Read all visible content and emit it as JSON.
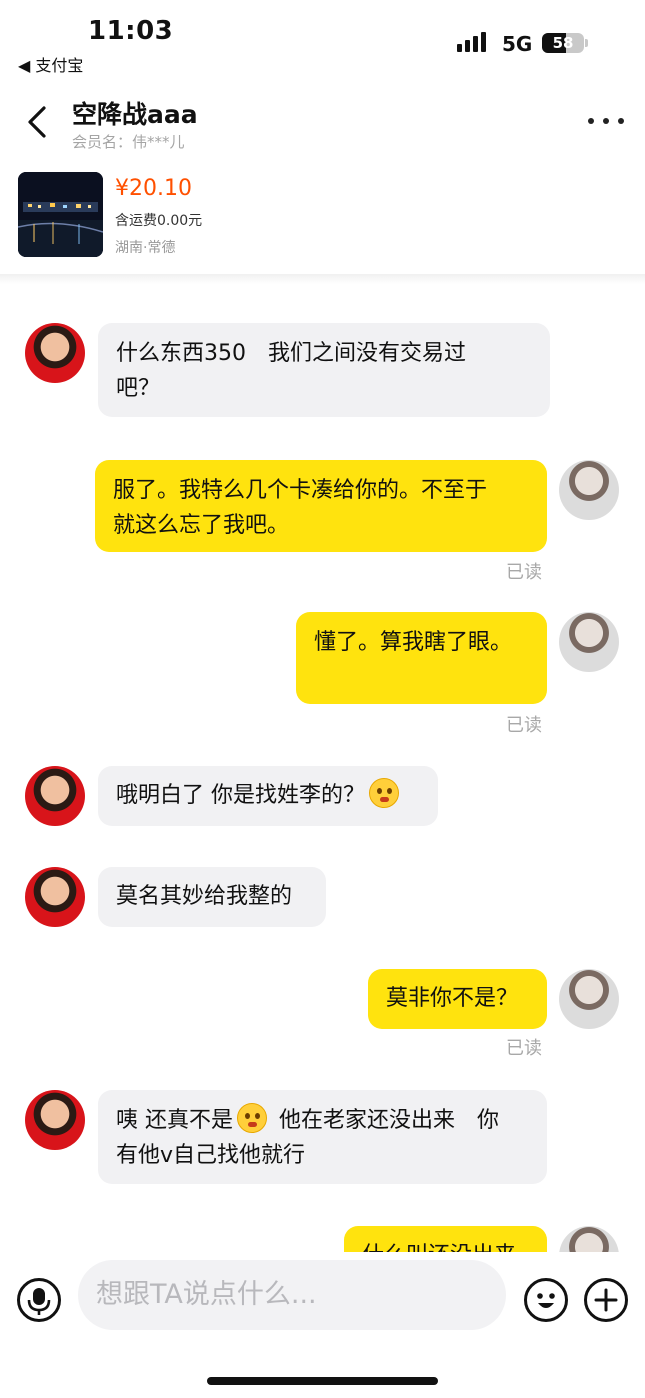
{
  "status_bar": {
    "time": "11:03",
    "back_app": "◀ 支付宝",
    "network": "5G",
    "battery": "58",
    "battery_level": 0.58
  },
  "header": {
    "title": "空降战aaa",
    "subtitle": "会员名：伟***儿"
  },
  "product": {
    "price": "¥20.10",
    "shipping": "含运费0.00元",
    "location": "湖南·常德"
  },
  "messages": [
    {
      "side": "in",
      "lines": [
        "什么东西350　我们之间没有交易过",
        "吧？"
      ]
    },
    {
      "side": "out",
      "lines": [
        "服了。我特么几个卡凑给你的。不至于",
        "就这么忘了我吧。"
      ],
      "status": "已读"
    },
    {
      "side": "out",
      "lines": [
        "懂了。算我瞎了眼。"
      ],
      "status": "已读"
    },
    {
      "side": "in",
      "lines": [
        "哦明白了 你是找姓李的？"
      ],
      "emoji": "astonished-emoji"
    },
    {
      "side": "in",
      "lines": [
        "莫名其妙给我整的"
      ]
    },
    {
      "side": "out",
      "lines": [
        "莫非你不是？"
      ],
      "status": "已读"
    },
    {
      "side": "in",
      "lines": [
        "咦 还真不是",
        "他在老家还没出来　你",
        "有他v自己找他就行"
      ],
      "emoji": "grinning-emoji"
    },
    {
      "side": "out",
      "lines": [
        "什么叫还没出来"
      ]
    }
  ],
  "input": {
    "placeholder": "想跟TA说点什么..."
  },
  "colors": {
    "price": "#ff5000",
    "bubble_out": "#ffe30e",
    "bubble_in": "#f1f1f3"
  }
}
